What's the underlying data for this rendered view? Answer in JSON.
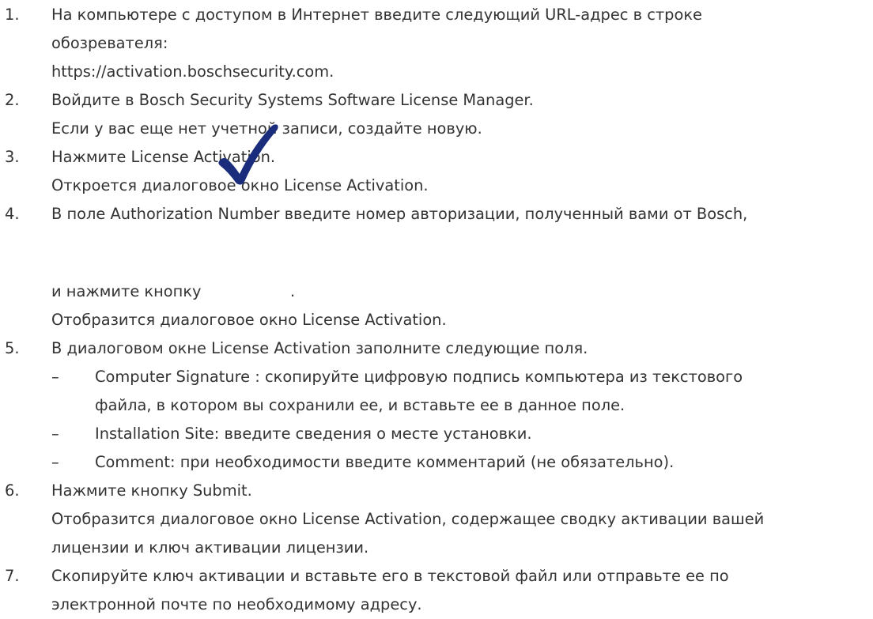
{
  "steps": [
    {
      "number": "1.",
      "lines": [
        "На компьютере с доступом в Интернет введите следующий URL-адрес в строке",
        "обозревателя:",
        "https://activation.boschsecurity.com."
      ]
    },
    {
      "number": "2.",
      "lines": [
        "Войдите в Bosch Security Systems Software License Manager.",
        "Если у вас еще нет учетной записи, создайте новую."
      ]
    },
    {
      "number": "3.",
      "lines": [
        "Нажмите License Activation.",
        "Откроется диалоговое окно License Activation."
      ]
    },
    {
      "number": "4.",
      "lines": [
        "В поле Authorization Number введите номер авторизации, полученный вами от Bosch,",
        "и нажмите кнопку",
        ".",
        "Отобразится диалоговое окно License Activation."
      ],
      "icon": "checkmark-icon",
      "icon_color": "#1a2d7c"
    },
    {
      "number": "5.",
      "lines": [
        "В диалоговом окне License Activation заполните следующие поля."
      ],
      "bullets": [
        {
          "dash": "–",
          "lines": [
            "Computer Signature : скопируйте цифровую подпись компьютера из текстового",
            "файла, в котором вы сохранили ее, и вставьте ее в данное поле."
          ]
        },
        {
          "dash": "–",
          "lines": [
            "Installation Site: введите сведения о месте установки."
          ]
        },
        {
          "dash": "–",
          "lines": [
            "Comment: при необходимости введите комментарий (не обязательно)."
          ]
        }
      ]
    },
    {
      "number": "6.",
      "lines": [
        "Нажмите кнопку Submit.",
        "Отобразится диалоговое окно License Activation, содержащее сводку активации вашей",
        "лицензии и ключ активации лицензии."
      ]
    },
    {
      "number": "7.",
      "lines": [
        "Скопируйте ключ активации и вставьте его в текстовой файл или отправьте ее по",
        "электронной почте по необходимому адресу."
      ]
    }
  ]
}
